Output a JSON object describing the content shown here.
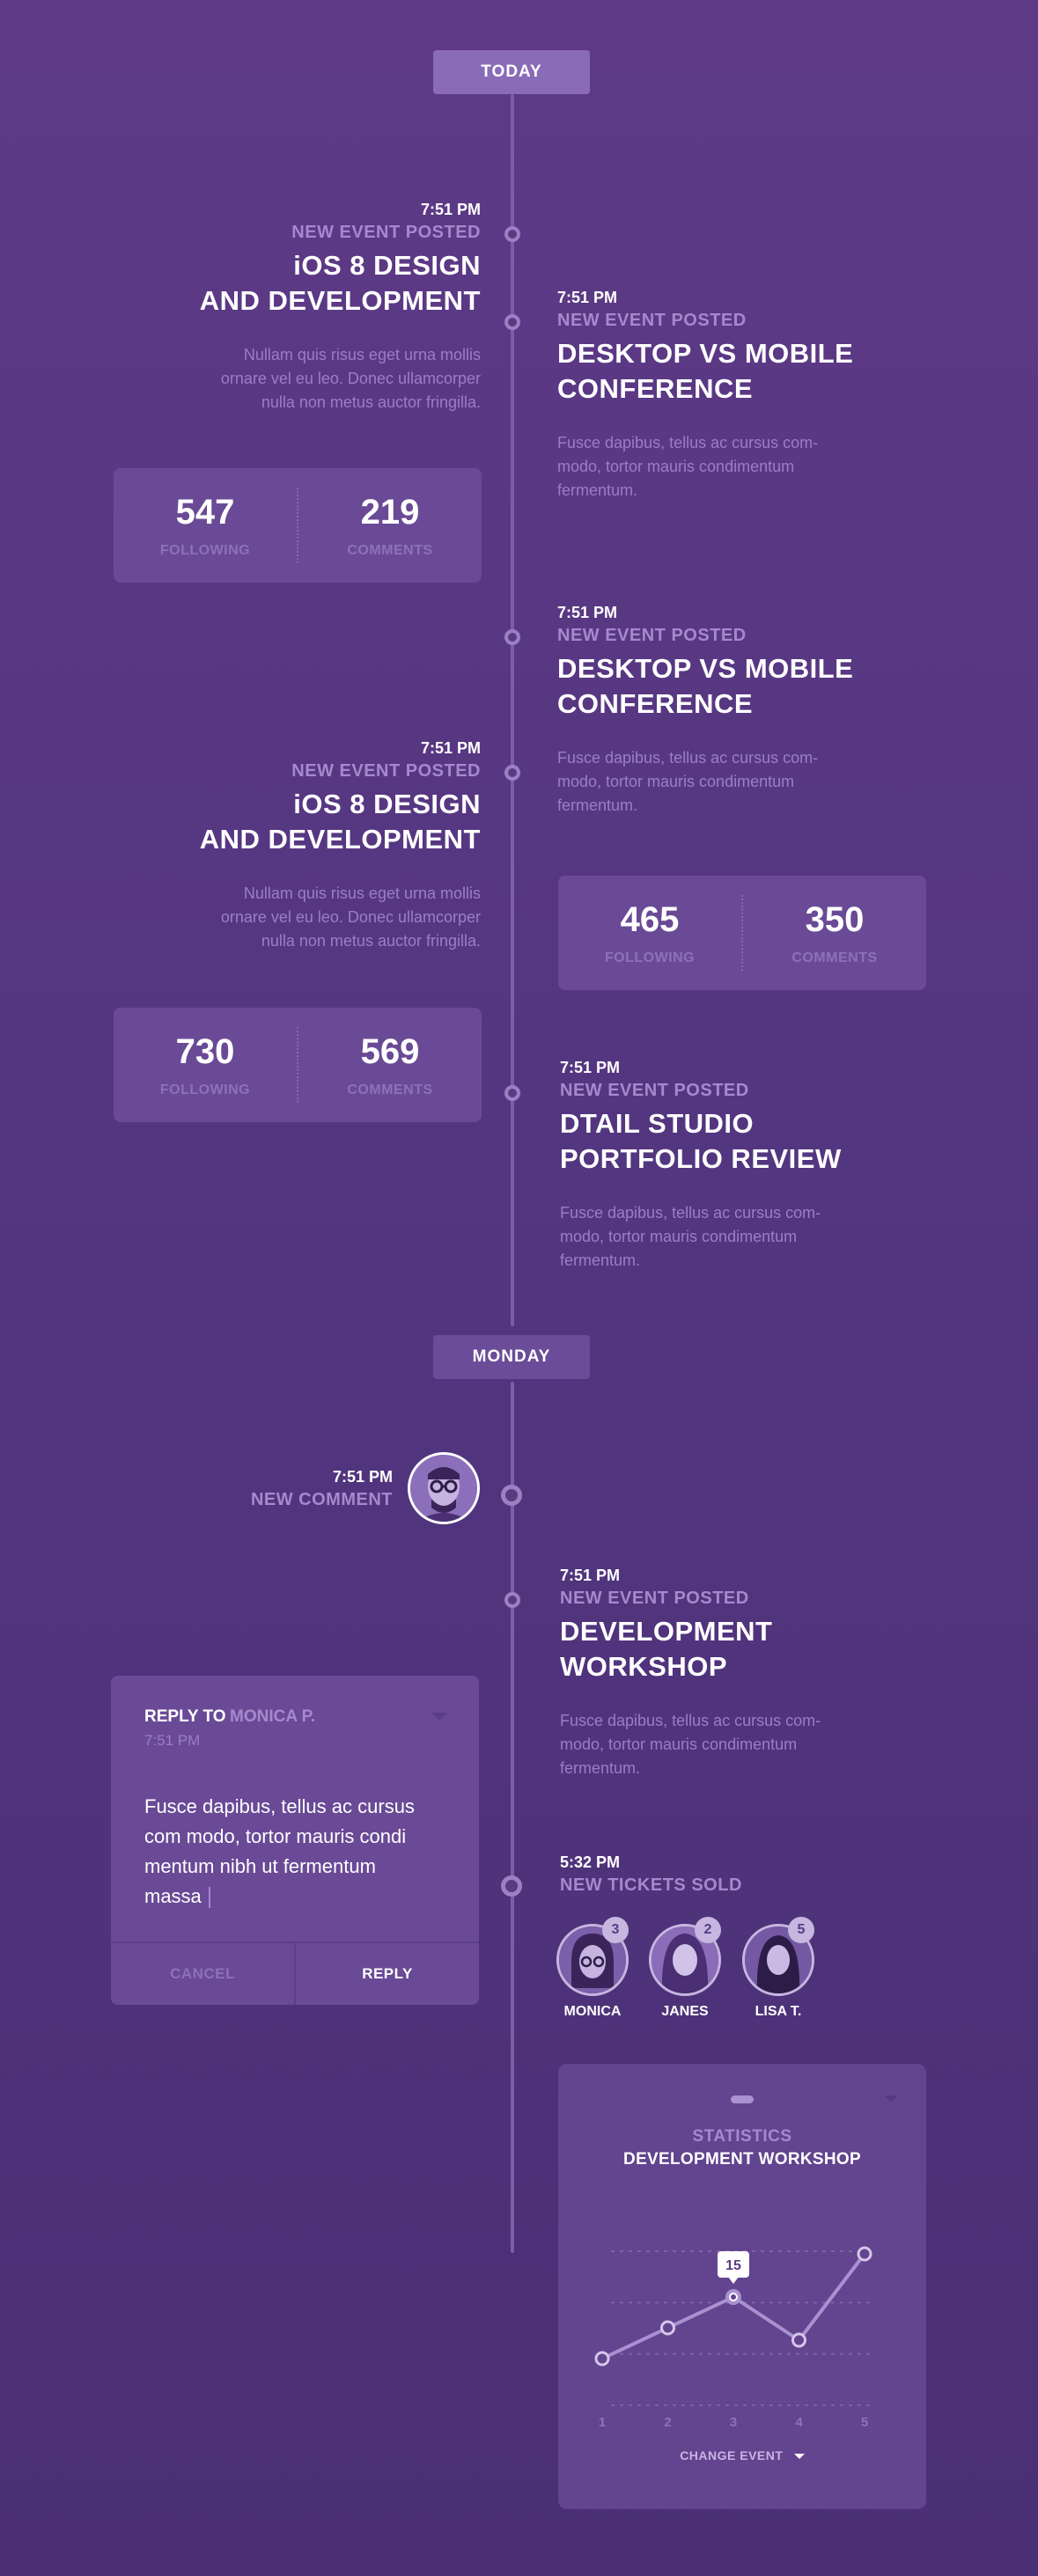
{
  "day_labels": {
    "today": "TODAY",
    "monday": "MONDAY"
  },
  "colors": {
    "background": "#5e3a86",
    "card": "#6a4a96",
    "accent": "#a689cc",
    "label_bg": "#8a6bb8"
  },
  "events": [
    {
      "time": "7:51 PM",
      "type": "NEW EVENT POSTED",
      "title_line1": "iOS 8 DESIGN",
      "title_line2": "AND DEVELOPMENT",
      "desc_line1": "Nullam quis risus eget urna mollis",
      "desc_line2": "ornare vel eu leo. Donec ullamcorper",
      "desc_line3": "nulla non metus auctor fringilla.",
      "stat1_value": "547",
      "stat1_label": "FOLLOWING",
      "stat2_value": "219",
      "stat2_label": "COMMENTS"
    },
    {
      "time": "7:51 PM",
      "type": "NEW EVENT POSTED",
      "title_line1": "DESKTOP VS MOBILE",
      "title_line2": "CONFERENCE",
      "desc_line1": "Fusce dapibus, tellus ac cursus com-",
      "desc_line2": "modo, tortor mauris condimentum",
      "desc_line3": "fermentum."
    },
    {
      "time": "7:51 PM",
      "type": "NEW EVENT POSTED",
      "title_line1": "DESKTOP VS MOBILE",
      "title_line2": "CONFERENCE",
      "desc_line1": "Fusce dapibus, tellus ac cursus com-",
      "desc_line2": "modo, tortor mauris condimentum",
      "desc_line3": "fermentum.",
      "stat1_value": "465",
      "stat1_label": "FOLLOWING",
      "stat2_value": "350",
      "stat2_label": "COMMENTS"
    },
    {
      "time": "7:51 PM",
      "type": "NEW EVENT POSTED",
      "title_line1": "iOS 8 DESIGN",
      "title_line2": "AND DEVELOPMENT",
      "desc_line1": "Nullam quis risus eget urna mollis",
      "desc_line2": "ornare vel eu leo. Donec ullamcorper",
      "desc_line3": "nulla non metus auctor fringilla.",
      "stat1_value": "730",
      "stat1_label": "FOLLOWING",
      "stat2_value": "569",
      "stat2_label": "COMMENTS"
    },
    {
      "time": "7:51 PM",
      "type": "NEW EVENT POSTED",
      "title_line1": "DTAIL STUDIO",
      "title_line2": "PORTFOLIO REVIEW",
      "desc_line1": "Fusce dapibus, tellus ac cursus com-",
      "desc_line2": "modo, tortor mauris condimentum",
      "desc_line3": "fermentum."
    },
    {
      "time": "7:51 PM",
      "type": "NEW COMMENT"
    },
    {
      "time": "7:51 PM",
      "type": "NEW EVENT POSTED",
      "title_line1": "DEVELOPMENT",
      "title_line2": "WORKSHOP",
      "desc_line1": "Fusce dapibus, tellus ac cursus com-",
      "desc_line2": "modo, tortor mauris condimentum",
      "desc_line3": "fermentum."
    },
    {
      "time": "5:32 PM",
      "type": "NEW TICKETS SOLD"
    }
  ],
  "reply": {
    "prefix": "REPLY TO",
    "name": "MONICA P.",
    "time": "7:51 PM",
    "body_line1": "Fusce dapibus, tellus ac cursus",
    "body_line2": "com modo, tortor mauris condi",
    "body_line3": "mentum nibh ut fermentum",
    "body_line4": "massa",
    "cancel_label": "CANCEL",
    "reply_label": "REPLY"
  },
  "buyers": [
    {
      "name": "MONICA",
      "count": "3"
    },
    {
      "name": "JANES",
      "count": "2"
    },
    {
      "name": "LISA T.",
      "count": "5"
    }
  ],
  "stats_card": {
    "heading": "STATISTICS",
    "subheading": "DEVELOPMENT WORKSHOP",
    "highlight_value": "15",
    "change_label": "CHANGE EVENT"
  },
  "chart_data": {
    "type": "line",
    "x": [
      1,
      2,
      3,
      4,
      5
    ],
    "tick_labels": [
      "1",
      "2",
      "3",
      "4",
      "5"
    ],
    "values": [
      5,
      10,
      15,
      8,
      22
    ],
    "highlight_index": 2,
    "ylim": [
      0,
      25
    ],
    "grid": true
  }
}
